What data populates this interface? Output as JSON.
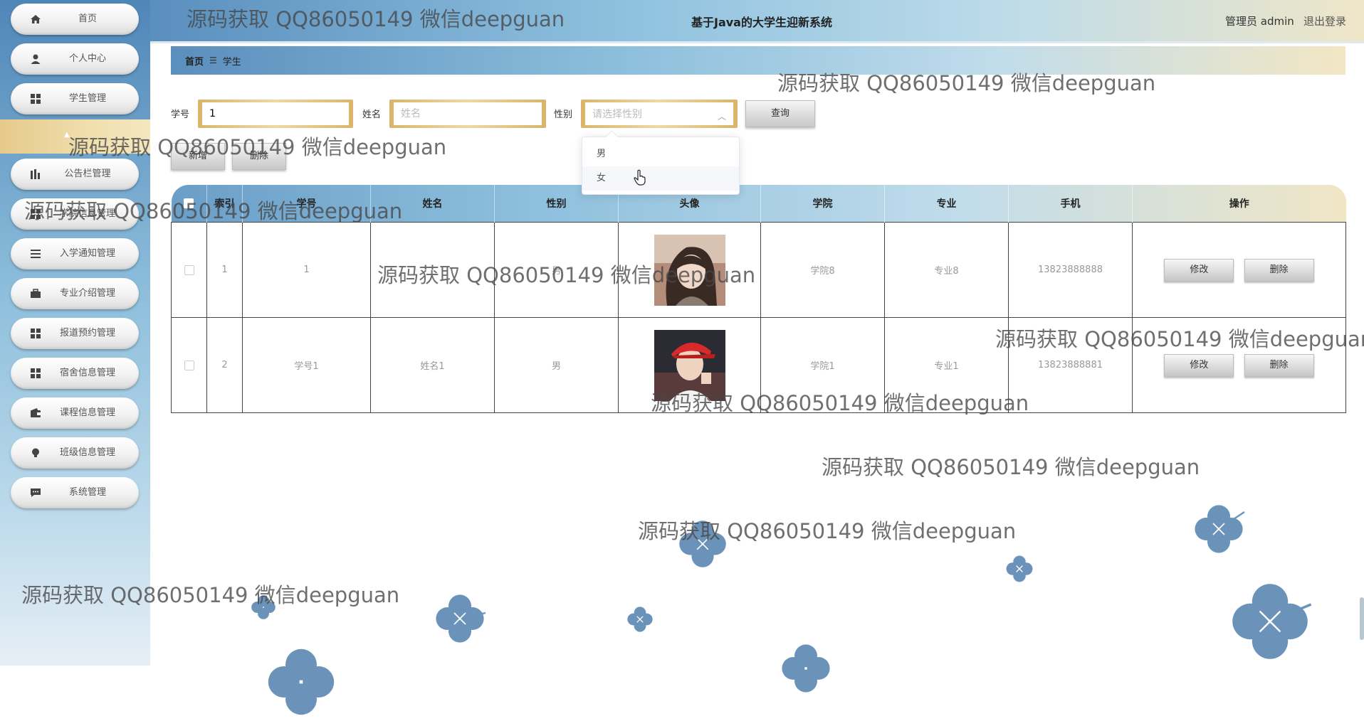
{
  "header": {
    "title": "基于Java的大学生迎新系统",
    "user": "管理员 admin",
    "logout": "退出登录"
  },
  "sidebar": {
    "items": [
      {
        "label": "首页",
        "icon": "home-icon"
      },
      {
        "label": "个人中心",
        "icon": "user-icon"
      },
      {
        "label": "学生管理",
        "icon": "grid-icon"
      },
      {
        "label": "公告栏管理",
        "icon": "chart-icon"
      },
      {
        "label": "学院信息管理",
        "icon": "grid-icon"
      },
      {
        "label": "入学通知管理",
        "icon": "list-icon"
      },
      {
        "label": "专业介绍管理",
        "icon": "briefcase-icon"
      },
      {
        "label": "报道预约管理",
        "icon": "grid-icon"
      },
      {
        "label": "宿舍信息管理",
        "icon": "grid-icon"
      },
      {
        "label": "课程信息管理",
        "icon": "wallet-icon"
      },
      {
        "label": "班级信息管理",
        "icon": "bulb-icon"
      },
      {
        "label": "系统管理",
        "icon": "chat-icon"
      }
    ]
  },
  "breadcrumb": {
    "home": "首页",
    "separator": "☰",
    "current": "学生"
  },
  "search": {
    "student_no_label": "学号",
    "student_no_value": "1",
    "name_label": "姓名",
    "name_placeholder": "姓名",
    "gender_label": "性别",
    "gender_placeholder": "请选择性别",
    "query_button": "查询"
  },
  "gender_options": [
    "男",
    "女"
  ],
  "actions": {
    "add": "新增",
    "delete": "删除"
  },
  "table": {
    "columns": [
      "",
      "索引",
      "学号",
      "姓名",
      "性别",
      "头像",
      "学院",
      "专业",
      "手机",
      "操作"
    ],
    "rows": [
      {
        "index": "1",
        "student_no": "1",
        "name": "",
        "gender": "男",
        "college": "学院8",
        "major": "专业8",
        "phone": "13823888888"
      },
      {
        "index": "2",
        "student_no": "学号1",
        "name": "姓名1",
        "gender": "男",
        "college": "学院1",
        "major": "专业1",
        "phone": "13823888881"
      }
    ],
    "edit_label": "修改",
    "delete_label": "删除"
  },
  "watermark": "源码获取 QQ86050149 微信deepguan",
  "colors": {
    "accent_blue": "#5a8fbe",
    "accent_gold": "#e5c98a",
    "flower": "#6b93b9"
  }
}
